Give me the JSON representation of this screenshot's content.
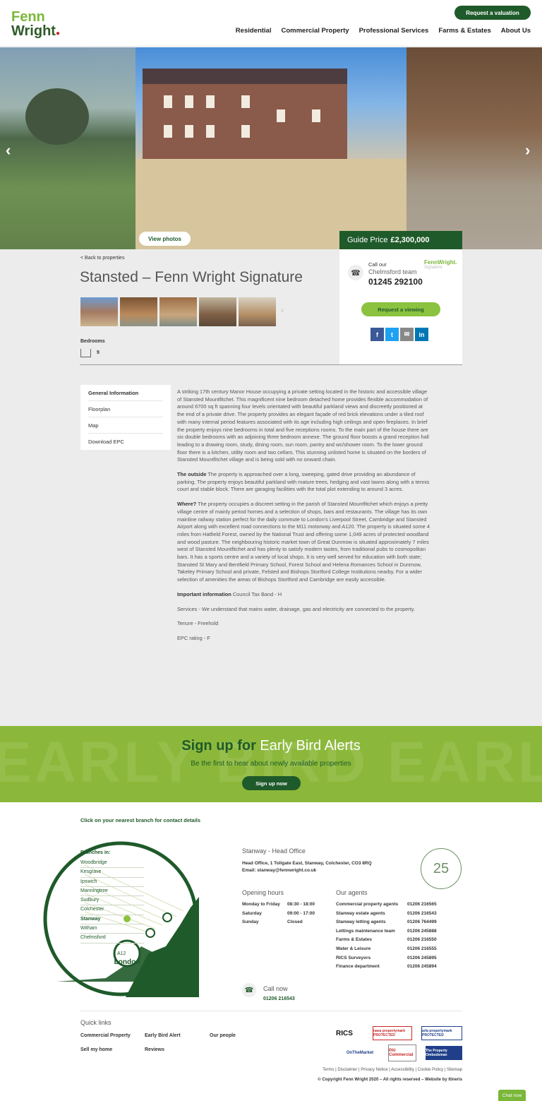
{
  "header": {
    "logo_line1": "Fenn",
    "logo_line2": "Wright",
    "valuation_button": "Request a valuation",
    "nav": [
      "Residential",
      "Commercial Property",
      "Professional Services",
      "Farms & Estates",
      "About Us"
    ]
  },
  "gallery": {
    "view_photos": "View photos",
    "prev_arrow": "‹",
    "next_arrow": "›"
  },
  "listing": {
    "back_link": "< Back to properties",
    "title": "Stansted – Fenn Wright Signature",
    "thumb_next": "›",
    "bedrooms_label": "Bedrooms",
    "bedrooms_count": "9",
    "guide_price_label": "Guide Price",
    "guide_price": "£2,300,000"
  },
  "contact_card": {
    "call_our": "Call our",
    "team": "Chelmsford team",
    "phone": "01245 292100",
    "signature_logo": "FennWright.",
    "signature_sub": "Signature",
    "request_viewing": "Request a viewing",
    "socials": [
      "f",
      "t",
      "✉",
      "in"
    ],
    "social_colors": [
      "#3b5998",
      "#1da1f2",
      "#888888",
      "#0077b5"
    ]
  },
  "sidemenu": [
    "General Information",
    "Floorplan",
    "Map",
    "Download EPC"
  ],
  "description": {
    "intro": "A striking 17th century Manor House occupying a private setting located in the historic and accessible village of Stansted Mountfitchet. This magnificent nine bedroom detached home provides flexible accommodation of around 6700 sq ft spanning four levels orientated with beautiful parkland views and discreetly positioned at the end of a private drive. The property provides an elegant façade of red brick elevations under a tiled roof with many internal period features associated with its age including high ceilings and open fireplaces. In brief the property enjoys nine bedrooms in total and five receptions rooms. To the main part of the house there are six double bedrooms with an adjoining three bedroom annexe. The ground floor boosts a grand reception hall leading to a drawing room, study, dining room, sun room, pantry and wc/shower room. To the lower ground floor there is a kitchen, utility room and two cellars. This stunning unlisted home is situated on the borders of Stansted Mountfitchet village and is being sold with no onward chain.",
    "outside_label": "The outside",
    "outside": "The property is approached over a long, sweeping, gated drive providing an abundance of parking. The property enjoys beautiful parkland with mature trees, hedging and vast lawns along with a tennis court and stable block. There are garaging facilities with the total plot extending to around 3 acres.",
    "where_label": "Where?",
    "where": "The property occupies a discreet setting in the parish of Stansted Mountfitchet which enjoys a pretty village centre of mainly period homes and a selection of shops, bars and restaurants. The village has its own mainline railway station perfect for the daily commute to London's Liverpool Street, Cambridge and Stansted Airport along with excellent road connections to the M11 motorway and A120. The property is situated some 4 miles from Hatfield Forest, owned by the National Trust and offering some 1,049 acres of protected woodland and wood pasture. The neighbouring historic market town of Great Dunmow is situated approximately 7 miles west of Stansted Mountfitchet and has plenty to satisfy modern tastes, from traditional pubs to cosmopolitan bars. It has a sports centre and a variety of local shops. It is very well served for education with both state; Stansted St Mary and Bentfield Primary School, Forest School and Helena Romances School in Dunmow, Takeley Primary School and private, Felsted and Bishops Stortford College Institutions nearby. For a wider selection of amenities the areas of Bishops Stortford and Cambridge are easily accessible.",
    "important_label": "Important information",
    "important": "Council Tax Band - H",
    "services": "Services - We understand that mains water, drainage, gas and electricity are connected to the property.",
    "tenure": "Tenure - Freehold",
    "epc": "EPC rating - F"
  },
  "earlybird": {
    "watermark": "EARLY BIRD EARLY",
    "title_bold": "Sign up for",
    "title_rest": "Early Bird Alerts",
    "subtitle": "Be the first to hear about newly available properties",
    "button": "Sign up now"
  },
  "branches": {
    "click_label": "Click on your nearest branch for contact details",
    "branches_in": "Branches in:",
    "list": [
      "Woodbridge",
      "Kesgrave",
      "Ipswich",
      "Manningtree",
      "Sudbury",
      "Colchester",
      "Stanway",
      "Witham",
      "Chelmsford"
    ],
    "active": "Stanway",
    "map_london": "London",
    "map_road": "A12"
  },
  "office": {
    "title": "Stanway - Head Office",
    "address": "Head Office, 1 Tollgate East, Stanway, Colchester, CO3 8RQ",
    "email": "Email: stanway@fennwright.co.uk",
    "badge": "25",
    "hours_heading": "Opening hours",
    "hours": [
      {
        "day": "Monday to Friday",
        "time": "08:30 - 18:00"
      },
      {
        "day": "Saturday",
        "time": "09:00 - 17:00"
      },
      {
        "day": "Sunday",
        "time": "Closed"
      }
    ],
    "agents_heading": "Our agents",
    "agents": [
      {
        "name": "Commercial property agents",
        "phone": "01206 216565"
      },
      {
        "name": "Stanway estate agents",
        "phone": "01206 216543"
      },
      {
        "name": "Stanway letting agents",
        "phone": "01206 764499"
      },
      {
        "name": "Lettings maintenance team",
        "phone": "01206 245888"
      },
      {
        "name": "Farms & Estates",
        "phone": "01206 216550"
      },
      {
        "name": "Water & Leisure",
        "phone": "01206 216555"
      },
      {
        "name": "RICS Surveyors",
        "phone": "01206 245895"
      },
      {
        "name": "Finance department",
        "phone": "01206 245894"
      }
    ],
    "call_now": "Call now",
    "call_now_number": "01206 216543"
  },
  "footer": {
    "quick_links_heading": "Quick links",
    "quick_links": [
      "Commercial Property",
      "Early Bird Alert",
      "Our people",
      "Sell my home",
      "Reviews"
    ],
    "badges": [
      "RICS",
      "naea propertymark PROTECTED",
      "arla propertymark PROTECTED",
      "OnTheMarket",
      "PAI Commercial",
      "The Property Ombudsman"
    ],
    "links": "Terms  |  Disclaimer  |  Privacy Notice  |  Accessibility  |  Cookie Policy  |  Sitemap",
    "copyright": "© Copyright Fenn Wright 2020 – All rights reserved – Website by Itineris",
    "chat": "Chat now"
  }
}
